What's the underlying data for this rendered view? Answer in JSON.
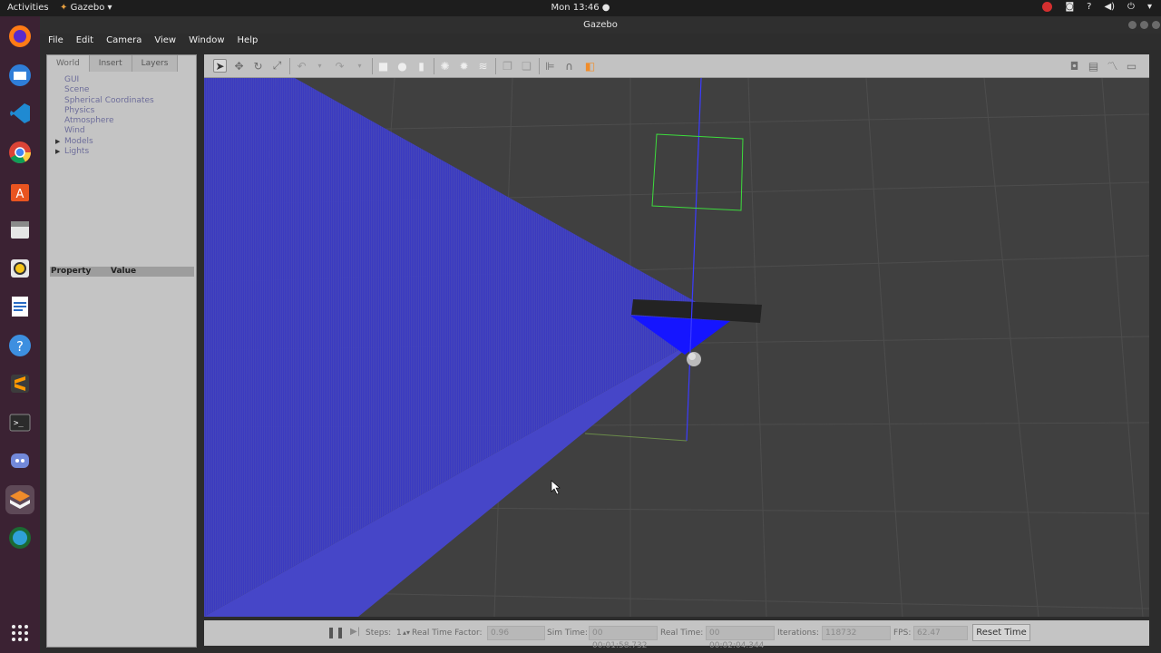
{
  "topbar": {
    "activities": "Activities",
    "app_name": "Gazebo",
    "clock": "Mon 13:46",
    "tray_help": "?"
  },
  "window": {
    "title": "Gazebo"
  },
  "menu": [
    "File",
    "Edit",
    "Camera",
    "View",
    "Window",
    "Help"
  ],
  "left_panel": {
    "tabs": [
      "World",
      "Insert",
      "Layers"
    ],
    "tree": [
      "GUI",
      "Scene",
      "Spherical Coordinates",
      "Physics",
      "Atmosphere",
      "Wind",
      "Models",
      "Lights"
    ],
    "property_header": {
      "property": "Property",
      "value": "Value"
    }
  },
  "bottom_bar": {
    "steps_label": "Steps:",
    "steps_value": "1",
    "rtf_label": "Real Time Factor:",
    "rtf_value": "0.96",
    "sim_time_label": "Sim Time:",
    "sim_time_value": "00 00:01:58.732",
    "real_time_label": "Real Time:",
    "real_time_value": "00 00:02:04.344",
    "iterations_label": "Iterations:",
    "iterations_value": "118732",
    "fps_label": "FPS:",
    "fps_value": "62.47",
    "reset_button": "Reset Time"
  },
  "colors": {
    "laser_ray": "#1a1aff",
    "grid": "#4d4d4d",
    "selection_box": "#3ddc3d",
    "z_axis": "#3b3bff",
    "dock_bg": "#3b2233"
  }
}
